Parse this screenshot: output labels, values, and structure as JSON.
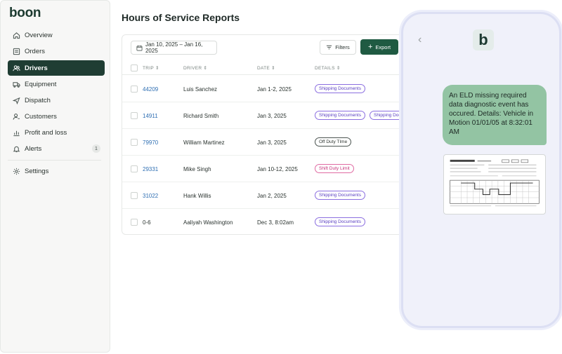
{
  "brand": {
    "logo_text": "boon",
    "accent": "#1f3d33",
    "export_green": "#1f5a42"
  },
  "sidebar": {
    "items": [
      {
        "label": "Overview",
        "icon": "home-icon"
      },
      {
        "label": "Orders",
        "icon": "orders-icon"
      },
      {
        "label": "Drivers",
        "icon": "users-icon",
        "active": true
      },
      {
        "label": "Equipment",
        "icon": "truck-icon"
      },
      {
        "label": "Dispatch",
        "icon": "send-icon"
      },
      {
        "label": "Customers",
        "icon": "customer-icon"
      },
      {
        "label": "Profit and loss",
        "icon": "chart-icon"
      },
      {
        "label": "Alerts",
        "icon": "bell-icon",
        "badge": "1"
      }
    ],
    "settings": {
      "label": "Settings",
      "icon": "gear-icon"
    }
  },
  "main": {
    "title": "Hours of Service Reports",
    "date_range": "Jan 10, 2025 – Jan 16, 2025",
    "filters_label": "Filters",
    "export_label": "Export",
    "columns": [
      "TRIP",
      "DRIVER",
      "DATE",
      "DETAILS"
    ],
    "rows": [
      {
        "trip": "44209",
        "driver": "Luis Sanchez",
        "date": "Jan 1-2, 2025",
        "tags": [
          {
            "text": "Shipping Documents",
            "kind": "purple"
          }
        ]
      },
      {
        "trip": "14911",
        "driver": "Richard Smith",
        "date": "Jan 3, 2025",
        "tags": [
          {
            "text": "Shipping Documents",
            "kind": "purple"
          },
          {
            "text": "Shipping Docu",
            "kind": "purple"
          }
        ]
      },
      {
        "trip": "79970",
        "driver": "William Martinez",
        "date": "Jan 3, 2025",
        "tags": [
          {
            "text": "Off Duty TIme",
            "kind": "gray"
          }
        ]
      },
      {
        "trip": "29331",
        "driver": "Mike Singh",
        "date": "Jan 10-12, 2025",
        "tags": [
          {
            "text": "Shift Duty Limit",
            "kind": "pink"
          }
        ]
      },
      {
        "trip": "31022",
        "driver": "Hank Willis",
        "date": "Jan 2, 2025",
        "tags": [
          {
            "text": "Shipping Documents",
            "kind": "purple"
          }
        ]
      },
      {
        "trip": "0-6",
        "driver": "Aaliyah Washington",
        "date": "Dec 3, 8:02am",
        "tags": [
          {
            "text": "Shipping Documents",
            "kind": "purple"
          }
        ]
      }
    ]
  },
  "phone": {
    "app_logo": "b",
    "message": "An ELD missing required data diagnostic event has occured. Details: Vehicle in Motion 01/01/05 at 8:32:01 AM",
    "bubble_color": "#93c4a3"
  }
}
